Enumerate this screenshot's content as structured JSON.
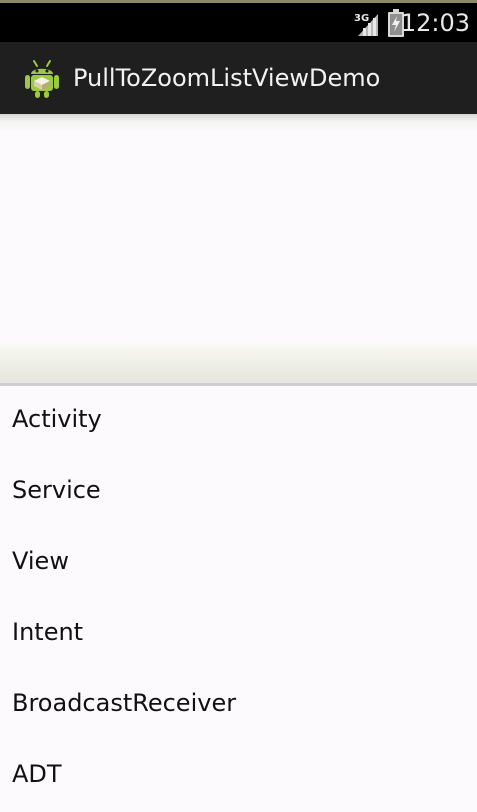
{
  "status_bar": {
    "network_type": "3G",
    "time": "12:03"
  },
  "action_bar": {
    "title": "PullToZoomListViewDemo",
    "icon": "android-app-icon"
  },
  "list": {
    "items": [
      "Activity",
      "Service",
      "View",
      "Intent",
      "BroadcastReceiver",
      "ADT"
    ]
  },
  "colors": {
    "status_bar": "#000000",
    "action_bar": "#1f1f1f",
    "background": "#fdfafd",
    "android_green": "#9bc93f"
  }
}
